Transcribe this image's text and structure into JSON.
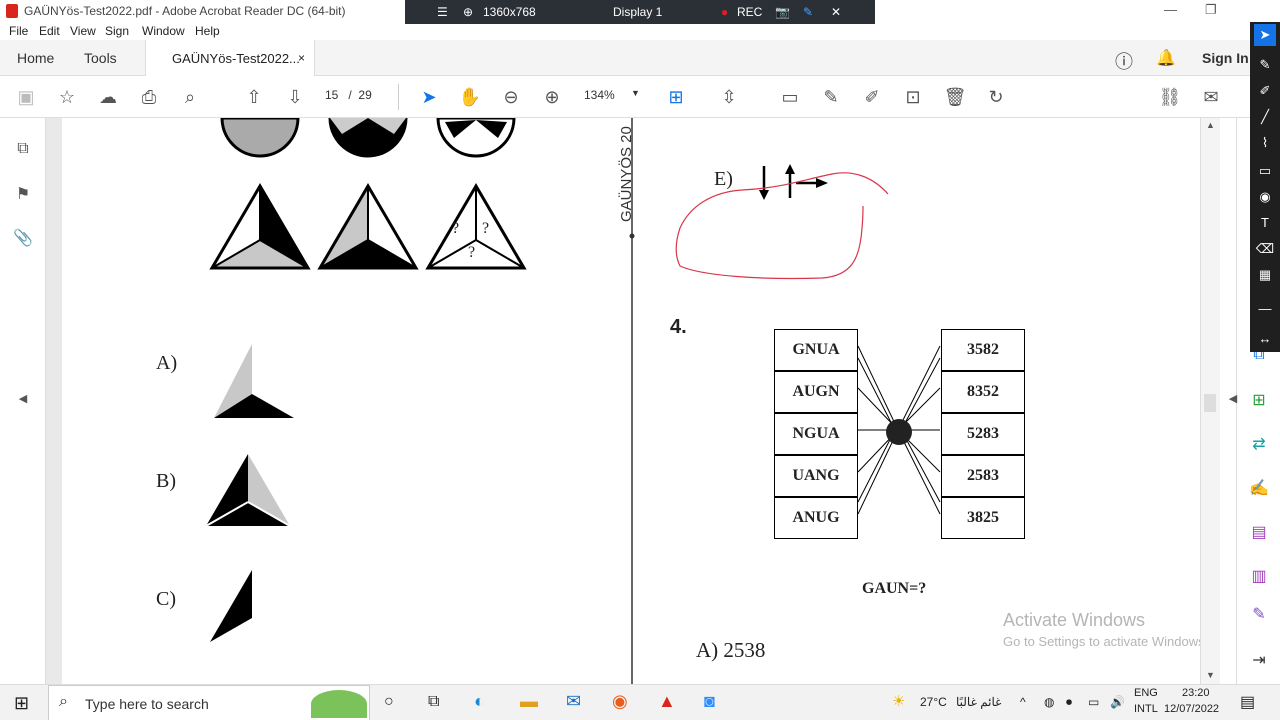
{
  "window": {
    "title": "GAÜNYös-Test2022.pdf - Adobe Acrobat Reader DC (64-bit)"
  },
  "share_bar": {
    "resolution": "1360x768",
    "display": "Display 1",
    "rec": "REC"
  },
  "menu": [
    "File",
    "Edit",
    "View",
    "Sign",
    "Window",
    "Help"
  ],
  "tabs": {
    "home": "Home",
    "tools": "Tools",
    "document": "GAÜNYös-Test2022...",
    "close": "×",
    "sign_in": "Sign In"
  },
  "toolbar": {
    "page_current": "15",
    "page_sep": "/",
    "page_total": "29",
    "zoom": "134%"
  },
  "document": {
    "left_page": {
      "option_a": "A)",
      "option_b": "B)",
      "option_c": "C)",
      "question_marks": [
        "?",
        "?",
        "?"
      ]
    },
    "right_page": {
      "side_label": "GAÜNYÖS 20",
      "option_e": "E)",
      "question_number": "4.",
      "left_words": [
        "GNUA",
        "AUGN",
        "NGUA",
        "UANG",
        "ANUG"
      ],
      "right_numbers": [
        "3582",
        "8352",
        "5283",
        "2583",
        "3825"
      ],
      "question": "GAUN=?",
      "answer_a": "A) 2538"
    },
    "watermark": {
      "title": "Activate Windows",
      "subtitle": "Go to Settings to activate Windows."
    }
  },
  "taskbar": {
    "search_placeholder": "Type here to search",
    "weather": "27°C",
    "weather_text": "غائم غالبًا",
    "lang_1": "ENG",
    "lang_2": "INTL",
    "time": "23:20",
    "date": "12/07/2022"
  }
}
